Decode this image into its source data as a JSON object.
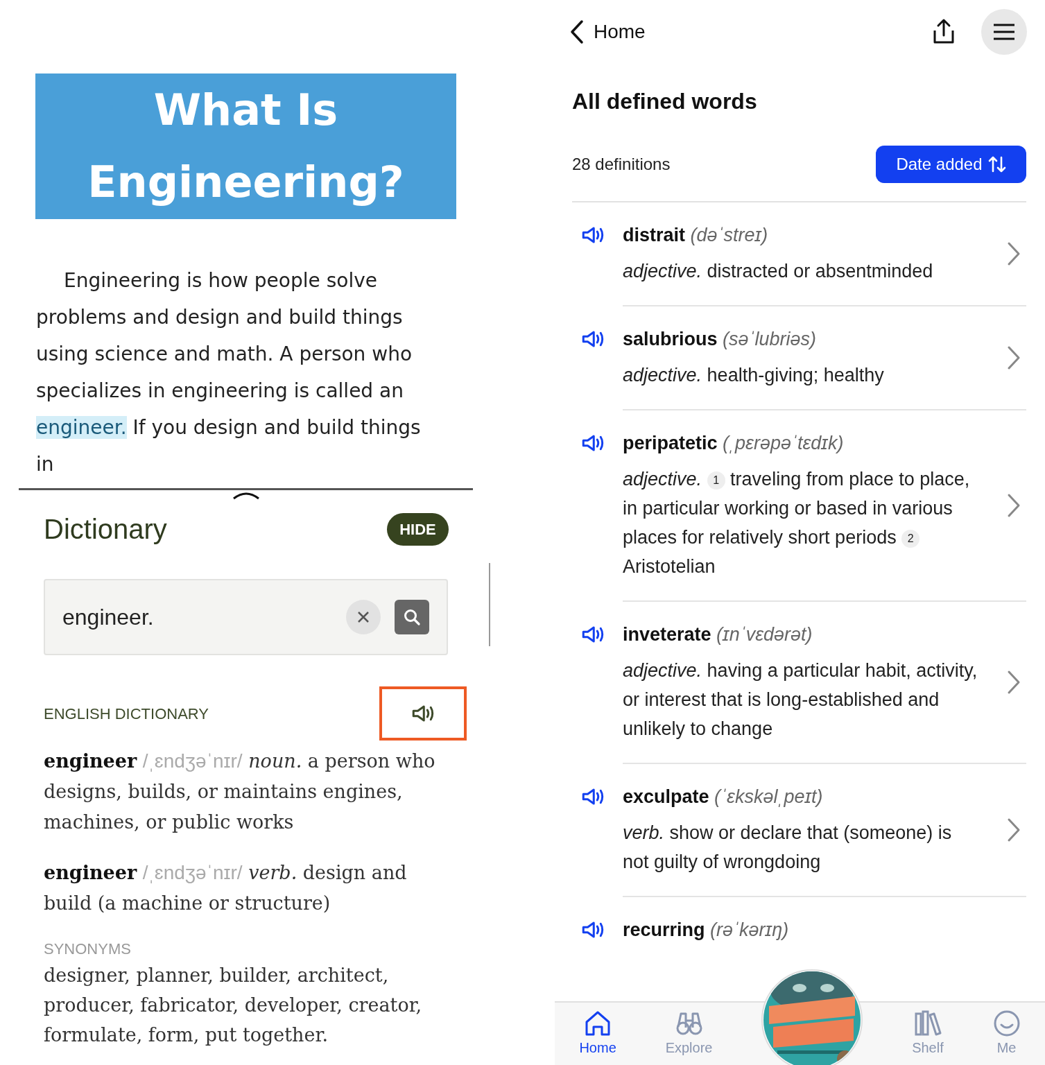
{
  "reader": {
    "title_lines": [
      "What Is",
      "Engineering?"
    ],
    "passage": {
      "before": "Engineering is how people solve problems and design and build things using science and math. A person who specializes in engineering is called an ",
      "highlighted": "engineer.",
      "after": " If you design and build things in"
    }
  },
  "dictionary": {
    "title": "Dictionary",
    "hide_button": "HIDE",
    "search": {
      "value": "engineer."
    },
    "source_label": "ENGLISH DICTIONARY",
    "entries": [
      {
        "headword": "engineer",
        "pronunciation": "/ˌɛndʒəˈnɪr/",
        "pos": "noun.",
        "definition": "a person who designs, builds, or maintains engines, machines, or public works"
      },
      {
        "headword": "engineer",
        "pronunciation": "/ˌɛndʒəˈnɪr/",
        "pos": "verb.",
        "definition": "design and build (a machine or structure)"
      }
    ],
    "synonyms_label": "SYNONYMS",
    "synonyms": "designer, planner, builder, architect, producer, fabricator, developer, creator, formulate, form, put together."
  },
  "header": {
    "back_label": "Home"
  },
  "words_page": {
    "title": "All defined words",
    "count": "28 definitions",
    "sort_button": "Date added",
    "words": [
      {
        "word": "distrait",
        "pronunciation": "(dəˈstreɪ)",
        "pos": "adjective.",
        "senses": [
          {
            "text": "distracted or absentminded"
          }
        ]
      },
      {
        "word": "salubrious",
        "pronunciation": "(səˈlubriəs)",
        "pos": "adjective.",
        "senses": [
          {
            "text": "health-giving; healthy"
          }
        ]
      },
      {
        "word": "peripatetic",
        "pronunciation": "(ˌpɛrəpəˈtɛdɪk)",
        "pos": "adjective.",
        "senses": [
          {
            "number": "1",
            "text": "traveling from place to place, in particular working or based in various places for relatively short periods"
          },
          {
            "number": "2",
            "text": "Aristotelian"
          }
        ]
      },
      {
        "word": "inveterate",
        "pronunciation": "(ɪnˈvɛdərət)",
        "pos": "adjective.",
        "senses": [
          {
            "text": "having a particular habit, activity, or interest that is long-established and unlikely to change"
          }
        ]
      },
      {
        "word": "exculpate",
        "pronunciation": "(ˈɛkskəlˌpeɪt)",
        "pos": "verb.",
        "senses": [
          {
            "text": "show or declare that (someone) is not guilty of wrongdoing"
          }
        ]
      },
      {
        "word": "recurring",
        "pronunciation": "(rəˈkərɪŋ)"
      }
    ]
  },
  "nav": {
    "tabs": [
      {
        "label": "Home",
        "selected": true
      },
      {
        "label": "Explore",
        "selected": false
      },
      {
        "kind": "picture"
      },
      {
        "label": "Shelf",
        "selected": false
      },
      {
        "label": "Me",
        "selected": false
      }
    ]
  }
}
